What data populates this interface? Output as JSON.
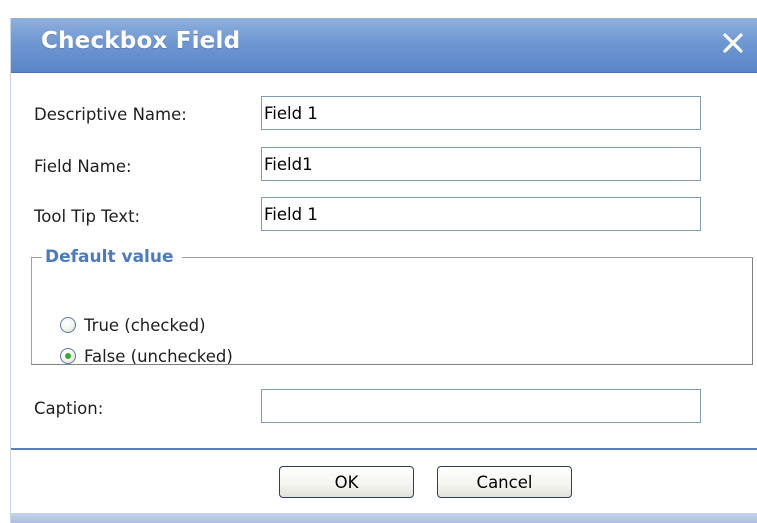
{
  "dialog": {
    "title": "Checkbox Field",
    "close_icon": "close-icon"
  },
  "fields": {
    "descriptive_name": {
      "label": "Descriptive Name:",
      "value": "Field 1"
    },
    "field_name": {
      "label": "Field Name:",
      "value": "Field1"
    },
    "tool_tip_text": {
      "label": "Tool Tip Text:",
      "value": "Field 1"
    },
    "caption": {
      "label": "Caption:",
      "value": ""
    }
  },
  "default_value": {
    "legend": "Default value",
    "options": [
      {
        "label": "True (checked)",
        "checked": false
      },
      {
        "label": "False (unchecked)",
        "checked": true
      }
    ]
  },
  "buttons": {
    "ok": "OK",
    "cancel": "Cancel"
  },
  "colors": {
    "title_bar": "#6f97d2",
    "legend_text": "#4a7bc0",
    "radio_selected": "#2fae2f",
    "input_border": "#7f9db9"
  }
}
